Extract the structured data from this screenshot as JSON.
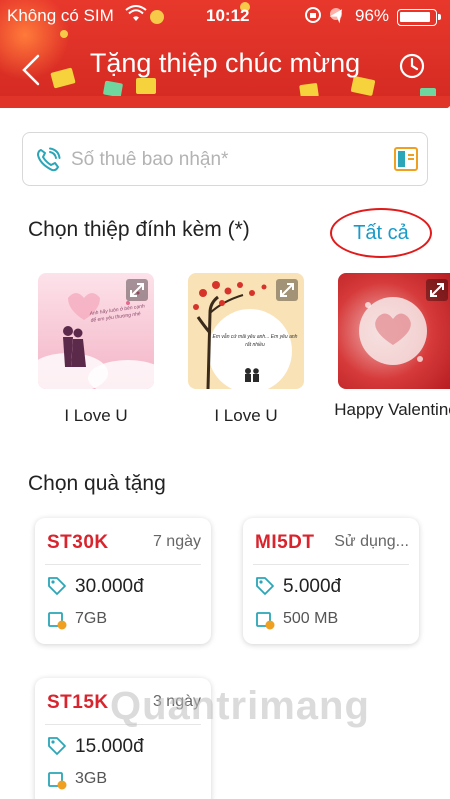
{
  "status_bar": {
    "carrier": "Không có SIM",
    "time": "10:12",
    "battery": "96%"
  },
  "header": {
    "title": "Tặng thiệp chúc mừng"
  },
  "recipient": {
    "placeholder": "Số thuê bao nhận*"
  },
  "cards_section": {
    "title": "Chọn thiệp đính kèm (*)",
    "see_all": "Tất cả",
    "cards": [
      {
        "label": "I Love U",
        "text": "Anh hãy luôn ở bên cạnh để em yêu thương nhé"
      },
      {
        "label": "I Love U",
        "text": "Em vẫn cứ mãi yêu anh... Em yêu anh rất nhiều"
      },
      {
        "label": "Happy Valentine"
      }
    ]
  },
  "gifts_section": {
    "title": "Chọn quà tặng",
    "gifts": [
      {
        "code": "ST30K",
        "duration": "7 ngày",
        "price": "30.000đ",
        "data": "7GB"
      },
      {
        "code": "MI5DT",
        "duration": "Sử dụng...",
        "price": "5.000đ",
        "data": "500 MB"
      },
      {
        "code": "ST15K",
        "duration": "3 ngày",
        "price": "15.000đ",
        "data": "3GB"
      }
    ]
  },
  "watermark": "Quantrimang",
  "colors": {
    "header_red": "#e8382c",
    "code_red": "#d9232d",
    "link_blue": "#1a9ac8",
    "icon_teal": "#2aa6b8",
    "icon_orange": "#f0a020"
  }
}
